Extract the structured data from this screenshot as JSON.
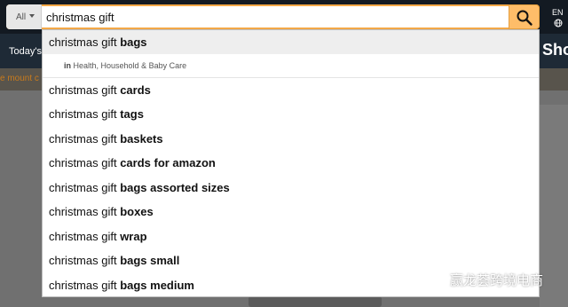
{
  "header": {
    "search": {
      "category_label": "All",
      "query": "christmas gift"
    },
    "language": "EN",
    "nav_left": "Today's",
    "nav_right": "Sho",
    "subbar_text": "e mount c"
  },
  "suggestions": [
    {
      "prefix": "christmas gift ",
      "bold": "bags"
    },
    {
      "prefix": "christmas gift ",
      "bold": "cards"
    },
    {
      "prefix": "christmas gift ",
      "bold": "tags"
    },
    {
      "prefix": "christmas gift ",
      "bold": "baskets"
    },
    {
      "prefix": "christmas gift ",
      "bold": "cards for amazon"
    },
    {
      "prefix": "christmas gift ",
      "bold": "bags assorted sizes"
    },
    {
      "prefix": "christmas gift ",
      "bold": "boxes"
    },
    {
      "prefix": "christmas gift ",
      "bold": "wrap"
    },
    {
      "prefix": "christmas gift ",
      "bold": "bags small"
    },
    {
      "prefix": "christmas gift ",
      "bold": "bags medium"
    }
  ],
  "suggestion_department": {
    "in_label": "in",
    "department": "Health, Household & Baby Care"
  },
  "watermark": {
    "text": "赢龙荟跨境电商"
  },
  "colors": {
    "header_bg": "#131a22",
    "nav_bg": "#1e2a36",
    "search_button": "#febd69",
    "search_border": "#f3a847",
    "highlight_row": "#eeeeee"
  }
}
